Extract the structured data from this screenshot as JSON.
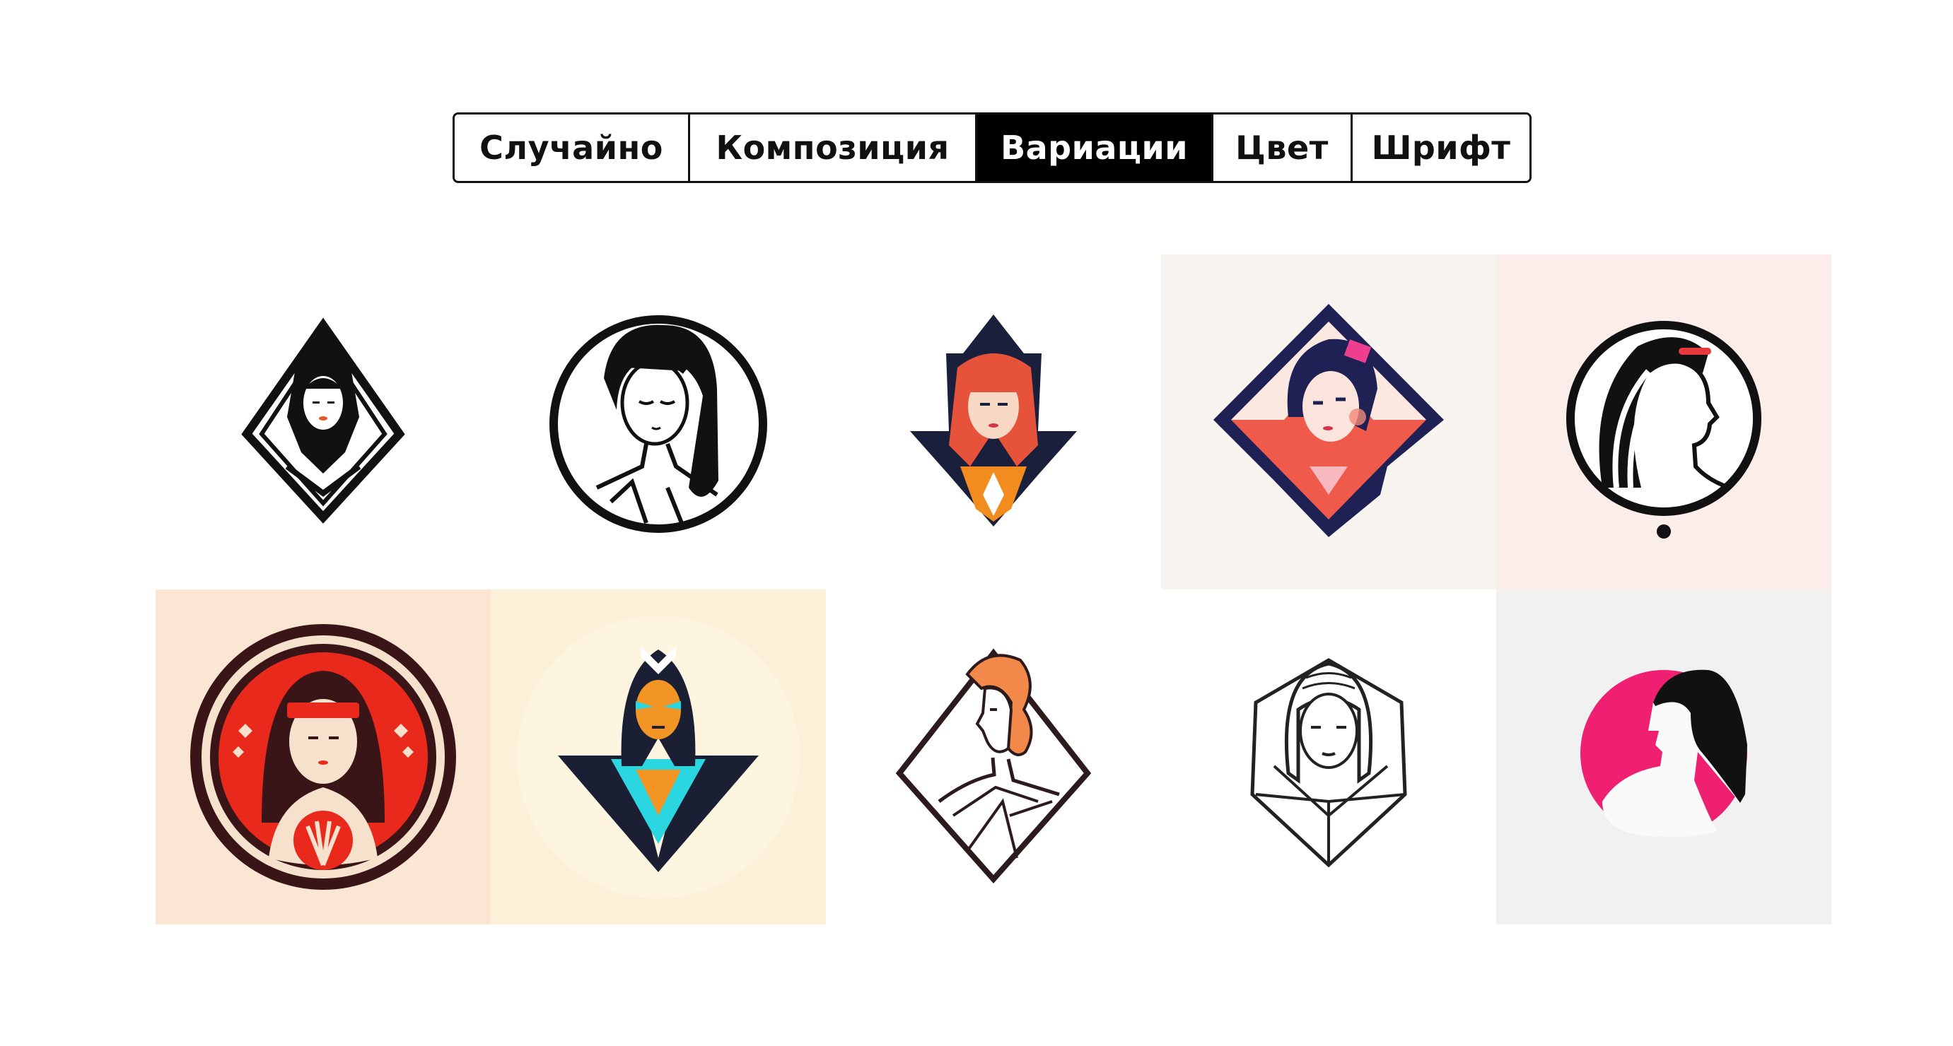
{
  "tabs": [
    {
      "label": "Случайно",
      "active": false
    },
    {
      "label": "Композиция",
      "active": false
    },
    {
      "label": "Вариации",
      "active": true
    },
    {
      "label": "Цвет",
      "active": false
    },
    {
      "label": "Шрифт",
      "active": false
    }
  ],
  "gallery": {
    "tiles": [
      {
        "icon": "woman-diamond-logo-icon",
        "background": "#ffffff"
      },
      {
        "icon": "woman-circle-logo-icon",
        "background": "#ffffff"
      },
      {
        "icon": "warrior-woman-logo-icon",
        "background": "#ffffff"
      },
      {
        "icon": "woman-diamond-color-logo-icon",
        "background": "#f7f4ef"
      },
      {
        "icon": "woman-profile-circle-logo-icon",
        "background": "#fbeeea"
      },
      {
        "icon": "woman-red-circle-logo-icon",
        "background": "#fbe6d3"
      },
      {
        "icon": "hero-woman-logo-icon",
        "background": "#fdf0d8"
      },
      {
        "icon": "woman-outline-diamond-logo-icon",
        "background": "#ffffff"
      },
      {
        "icon": "woman-hexagon-logo-icon",
        "background": "#ffffff"
      },
      {
        "icon": "woman-pink-circle-logo-icon",
        "background": "#f1f1f1"
      }
    ]
  }
}
